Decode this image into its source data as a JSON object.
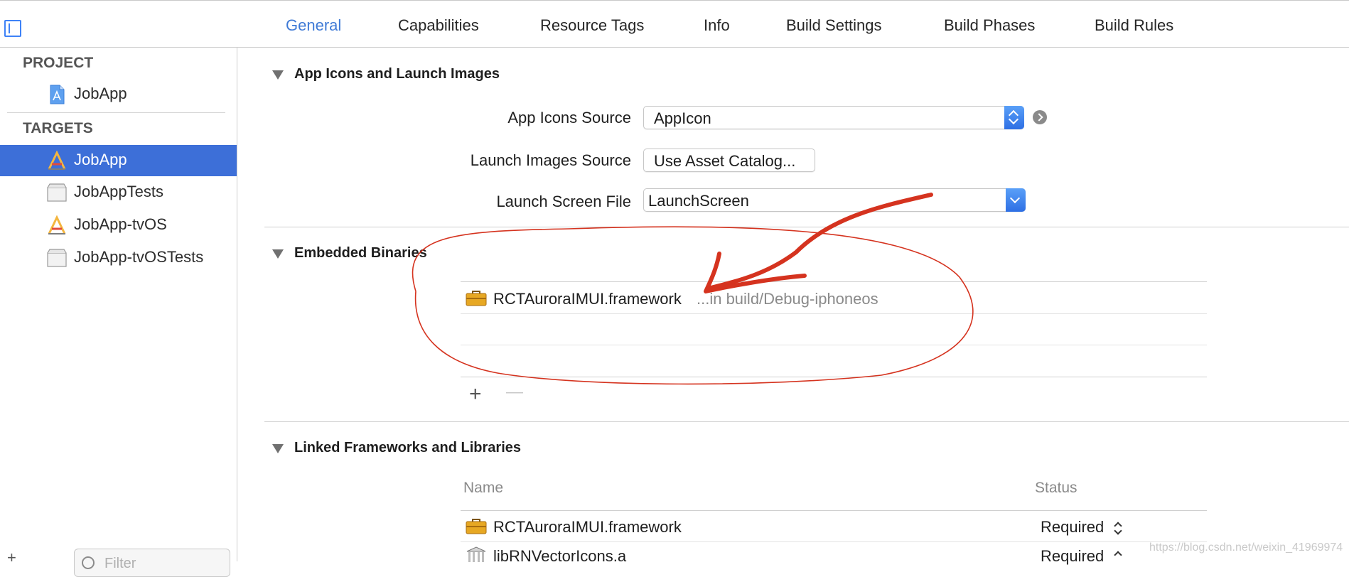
{
  "tabs": [
    {
      "label": "General",
      "active": true
    },
    {
      "label": "Capabilities",
      "active": false
    },
    {
      "label": "Resource Tags",
      "active": false
    },
    {
      "label": "Info",
      "active": false
    },
    {
      "label": "Build Settings",
      "active": false
    },
    {
      "label": "Build Phases",
      "active": false
    },
    {
      "label": "Build Rules",
      "active": false
    }
  ],
  "navigator": {
    "project_header": "PROJECT",
    "project_item": "JobApp",
    "targets_header": "TARGETS",
    "targets": [
      {
        "label": "JobApp",
        "icon": "app-target-icon",
        "selected": true
      },
      {
        "label": "JobAppTests",
        "icon": "test-bundle-icon",
        "selected": false
      },
      {
        "label": "JobApp-tvOS",
        "icon": "app-target-icon",
        "selected": false
      },
      {
        "label": "JobApp-tvOSTests",
        "icon": "test-bundle-icon",
        "selected": false
      }
    ],
    "filter_placeholder": "Filter"
  },
  "sections": {
    "app_icons": {
      "title": "App Icons and Launch Images",
      "app_icons_source_label": "App Icons Source",
      "app_icons_source_value": "AppIcon",
      "launch_images_source_label": "Launch Images Source",
      "launch_images_source_button": "Use Asset Catalog...",
      "launch_screen_file_label": "Launch Screen File",
      "launch_screen_file_value": "LaunchScreen"
    },
    "embedded_binaries": {
      "title": "Embedded Binaries",
      "rows": [
        {
          "name": "RCTAuroraIMUI.framework",
          "path": "...in build/Debug-iphoneos"
        }
      ],
      "add": "+",
      "remove": "—"
    },
    "linked_frameworks": {
      "title": "Linked Frameworks and Libraries",
      "columns": {
        "name": "Name",
        "status": "Status"
      },
      "rows": [
        {
          "name": "RCTAuroraIMUI.framework",
          "status": "Required",
          "icon": "framework-toolbox-icon"
        },
        {
          "name": "libRNVectorIcons.a",
          "status": "Required",
          "icon": "library-building-icon"
        }
      ]
    }
  },
  "watermark": "https://blog.csdn.net/weixin_41969974",
  "colors": {
    "accent": "#3f7ad6",
    "selection": "#3d6fd8",
    "annotation": "#d5331f"
  }
}
